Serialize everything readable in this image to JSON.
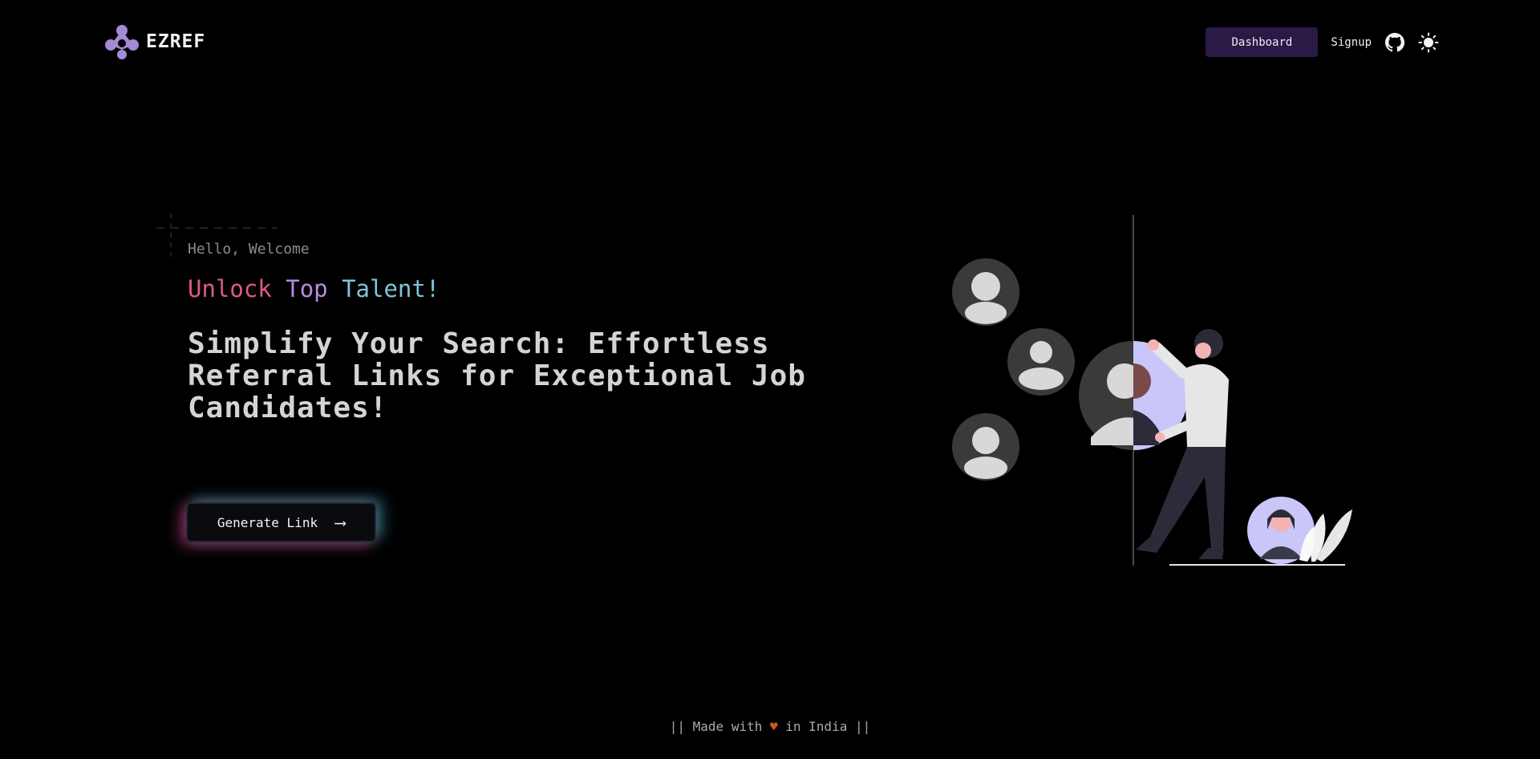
{
  "brand": {
    "name": "EZREF",
    "logo_icon": "ezref-logo-icon",
    "accent": "#a48ad6"
  },
  "nav": {
    "dashboard_label": "Dashboard",
    "signup_label": "Signup",
    "github_icon": "github-icon",
    "theme_icon": "sun-icon"
  },
  "hero": {
    "eyebrow": "Hello, Welcome",
    "tagline": {
      "word1": "Unlock",
      "word2": "Top",
      "word3": "Talent!"
    },
    "headline": "Simplify Your Search: Effortless Referral Links for Exceptional Job Candidates!",
    "cta_label": "Generate Link",
    "cta_arrow": "⟶",
    "illustration_icon": "people-search-illustration"
  },
  "footer": {
    "prefix": "|| Made with",
    "heart": "♥",
    "suffix": "in India ||"
  },
  "colors": {
    "background": "#000000",
    "dashboard_bg": "#2a1a45",
    "tagline_pink": "#e0578f",
    "tagline_purple": "#b58be0",
    "tagline_cyan": "#7fc4d8",
    "glow_pink": "#e04896",
    "glow_cyan": "#50c8dc",
    "heart": "#d0561f"
  }
}
